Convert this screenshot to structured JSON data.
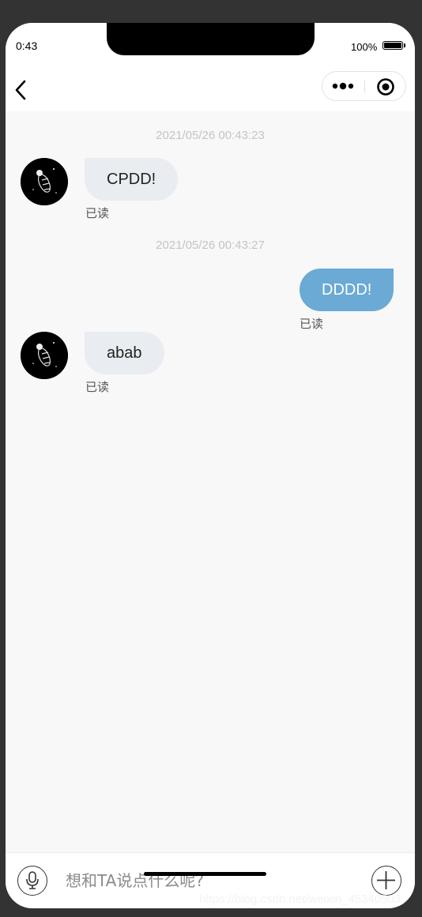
{
  "status_bar": {
    "time": "0:43",
    "battery": "100%"
  },
  "nav": {
    "back_icon": "chevron-left-icon",
    "more_icon": "more-dots-icon",
    "close_icon": "target-circle-icon"
  },
  "messages": [
    {
      "type": "timestamp",
      "text": "2021/05/26 00:43:23"
    },
    {
      "type": "message",
      "side": "left",
      "text": "CPDD!",
      "status": "已读"
    },
    {
      "type": "timestamp",
      "text": "2021/05/26 00:43:27"
    },
    {
      "type": "message",
      "side": "right",
      "text": "DDDD!",
      "status": "已读"
    },
    {
      "type": "message",
      "side": "left",
      "text": "abab",
      "status": "已读"
    }
  ],
  "input_bar": {
    "placeholder": "想和TA说点什么呢?",
    "voice_icon": "microphone-icon",
    "add_icon": "plus-icon"
  },
  "watermark": "https://blog.csdn.net/weixin_45340503",
  "colors": {
    "sent_bubble": "#6aaad4",
    "received_bubble": "#e9ecf0",
    "background": "#f8f8f8"
  }
}
